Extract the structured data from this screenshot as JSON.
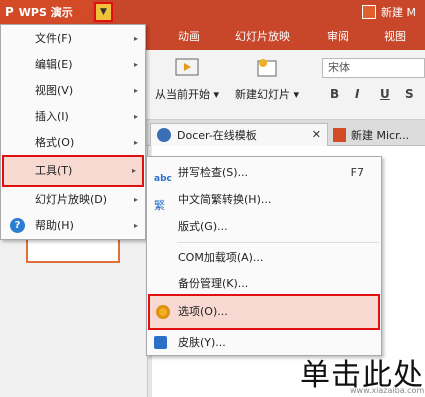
{
  "titlebar": {
    "app_logo": "P",
    "app_name": "WPS 演示",
    "dropdown_icon": "chevron-down-icon",
    "doc_label": "新建 M"
  },
  "ribbon_tabs": [
    "动画",
    "幻灯片放映",
    "审阅",
    "视图"
  ],
  "ribbon": {
    "from_current": "从当前开始 ▾",
    "new_slide": "新建幻灯片 ▾",
    "font_name": "宋体",
    "format_buttons": [
      "B",
      "I",
      "U",
      "S"
    ]
  },
  "doc_tabs": {
    "docer": "Docer-在线模板",
    "close": "✕",
    "ppt": "新建 Micr..."
  },
  "main_menu": [
    {
      "label": "文件(F)",
      "arrow": "▸"
    },
    {
      "label": "编辑(E)",
      "arrow": "▸"
    },
    {
      "label": "视图(V)",
      "arrow": "▸"
    },
    {
      "label": "插入(I)",
      "arrow": "▸"
    },
    {
      "label": "格式(O)",
      "arrow": "▸"
    },
    {
      "label": "工具(T)",
      "arrow": "▸"
    },
    {
      "label": "幻灯片放映(D)",
      "arrow": "▸"
    },
    {
      "label": "帮助(H)",
      "arrow": "▸"
    }
  ],
  "tools_menu": [
    {
      "label": "拼写检查(S)...",
      "shortcut": "F7",
      "icon": "abc"
    },
    {
      "label": "中文简繁转换(H)...",
      "shortcut": "",
      "icon": "繁"
    },
    {
      "label": "版式(G)...",
      "shortcut": ""
    },
    {
      "label": "COM加载项(A)...",
      "shortcut": ""
    },
    {
      "label": "备份管理(K)...",
      "shortcut": ""
    },
    {
      "label": "选项(O)...",
      "shortcut": ""
    },
    {
      "label": "皮肤(Y)...",
      "shortcut": ""
    }
  ],
  "watermark": {
    "text": "单击此处",
    "sub": "www.xiazaiba.com"
  }
}
